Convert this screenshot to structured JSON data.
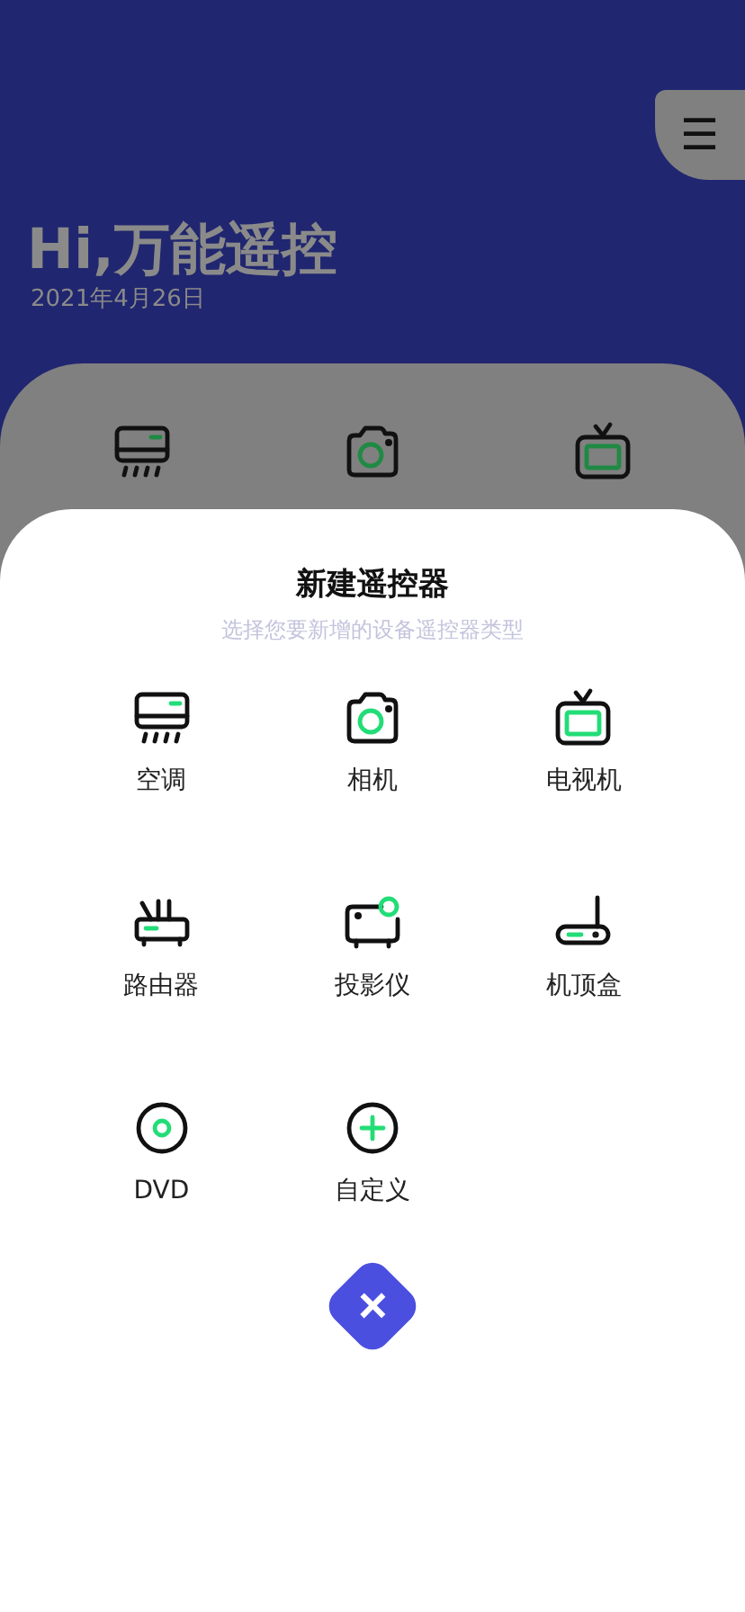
{
  "header": {
    "menu_icon": "☰",
    "greeting": "Hi,万能遥控",
    "date": "2021年4月26日"
  },
  "my_devices": [
    {
      "kind": "ac"
    },
    {
      "kind": "camera"
    },
    {
      "kind": "tv"
    }
  ],
  "sheet": {
    "title": "新建遥控器",
    "subtitle": "选择您要新增的设备遥控器类型",
    "types": [
      {
        "kind": "ac",
        "label": "空调"
      },
      {
        "kind": "camera",
        "label": "相机"
      },
      {
        "kind": "tv",
        "label": "电视机"
      },
      {
        "kind": "router",
        "label": "路由器"
      },
      {
        "kind": "projector",
        "label": "投影仪"
      },
      {
        "kind": "settopbox",
        "label": "机顶盒"
      },
      {
        "kind": "dvd",
        "label": "DVD"
      },
      {
        "kind": "custom",
        "label": "自定义"
      }
    ],
    "close": "×"
  }
}
